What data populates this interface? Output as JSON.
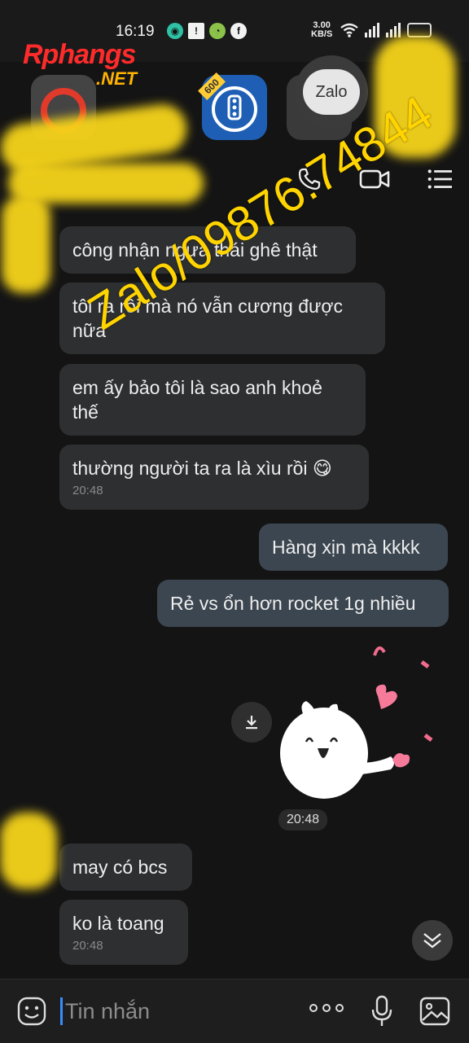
{
  "status_bar": {
    "time": "16:19",
    "net_speed_value": "3.00",
    "net_speed_unit": "KB/S"
  },
  "watermark": {
    "brand": "Rphangs",
    "brand_suffix": ".NET",
    "promo": "Zalo/09876.74844"
  },
  "launcher": {
    "badge": "600",
    "zalo_label": "Zalo"
  },
  "messages": [
    {
      "text": "công nhận ngựa thái ghê thật"
    },
    {
      "text": "tôi ra rồi mà nó vẫn cương được nữa"
    },
    {
      "text": "em ấy bảo tôi là sao anh khoẻ thế"
    },
    {
      "text": "thường người ta ra là xìu rồi 😋",
      "time": "20:48"
    },
    {
      "text": "Hàng xịn mà kkkk"
    },
    {
      "text": "Rẻ vs ổn hơn rocket 1g nhiều"
    },
    {
      "sticker_time": "20:48"
    },
    {
      "text": "may có bcs"
    },
    {
      "text": "ko là toang",
      "time": "20:48"
    }
  ],
  "composer": {
    "placeholder": "Tin nhắn"
  },
  "colors": {
    "bubble_in": "#2d2f31",
    "bubble_out": "#3c4650",
    "accent": "#3b8cff",
    "watermark_yellow": "#ffd400"
  }
}
